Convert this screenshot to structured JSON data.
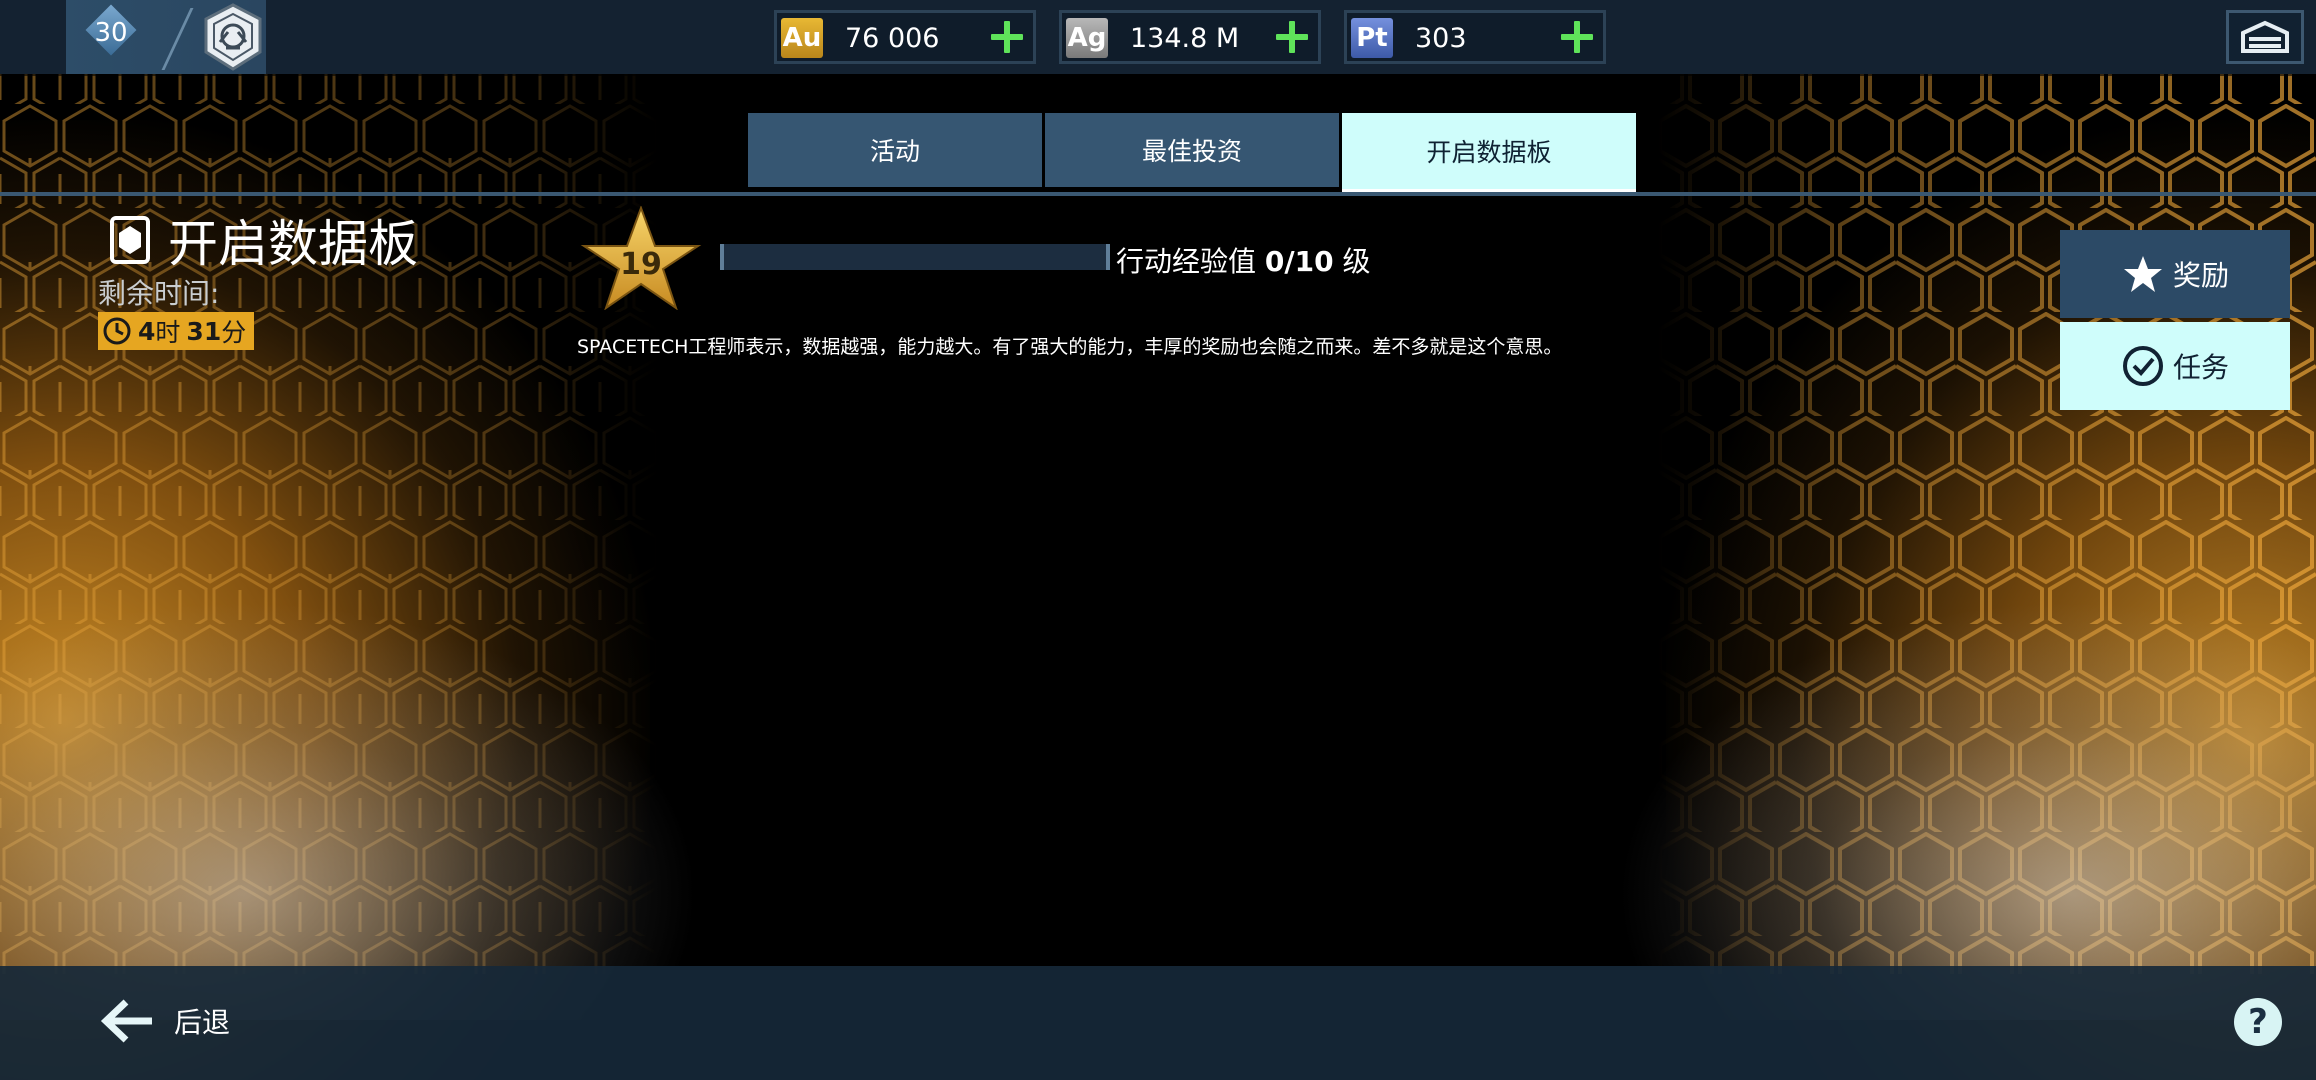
{
  "header": {
    "level": "30",
    "currencies": [
      {
        "code": "Au",
        "value": "76 006",
        "color": "#d9a52a"
      },
      {
        "code": "Ag",
        "value": "134.8 M",
        "color": "#9a9a9a"
      },
      {
        "code": "Pt",
        "value": "303",
        "color": "#5a76c2"
      }
    ]
  },
  "tabs": [
    {
      "label": "活动"
    },
    {
      "label": "最佳投资"
    },
    {
      "label": "开启数据板"
    }
  ],
  "event": {
    "title": "开启数据板",
    "remaining_label": "剩余时间:",
    "timer_hours": "4",
    "timer_hours_unit": "时",
    "timer_minutes": "31",
    "timer_minutes_unit": "分"
  },
  "progress": {
    "star_level": "19",
    "exp_label": "行动经验值",
    "exp_value": "0/10",
    "exp_unit": "级",
    "fill_fraction": 0.0
  },
  "description": "SPACETECH工程师表示，数据越强，能力越大。有了强大的能力，丰厚的奖励也会随之而来。差不多就是这个意思。",
  "side_buttons": {
    "rewards": "奖励",
    "tasks": "任务"
  },
  "footer": {
    "back": "后退",
    "help": "?"
  },
  "colors": {
    "accent_cyan": "#cffdfb",
    "tab_blue": "#365672",
    "timer_gold": "#e6a621",
    "plus_green": "#5fe35a"
  }
}
